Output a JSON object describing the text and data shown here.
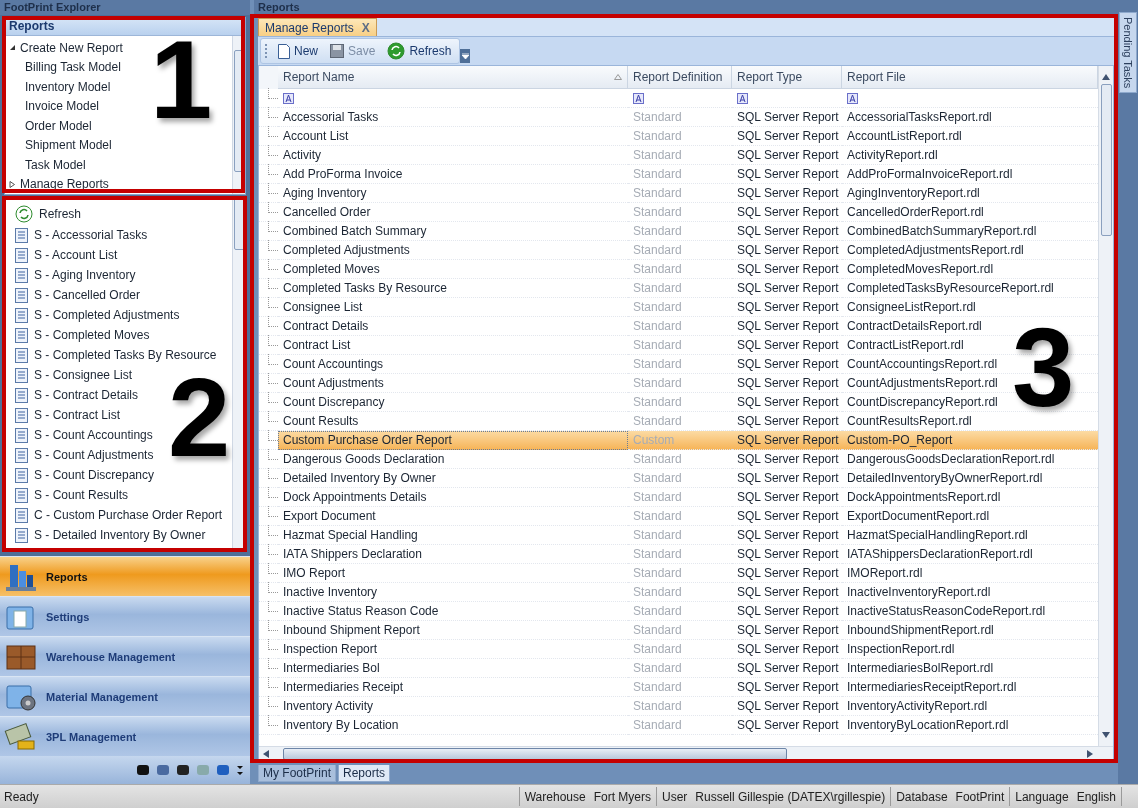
{
  "left_pane": {
    "title": "FootPrint Explorer",
    "section_title": "Reports",
    "tree": [
      {
        "label": "Create New Report",
        "expanded": true,
        "children": [
          {
            "label": "Billing Task Model"
          },
          {
            "label": "Inventory Model"
          },
          {
            "label": "Invoice Model"
          },
          {
            "label": "Order Model"
          },
          {
            "label": "Shipment Model"
          },
          {
            "label": "Task Model"
          }
        ]
      },
      {
        "label": "Manage Reports",
        "expanded": false
      }
    ],
    "refresh": "Refresh",
    "report_list": [
      "S - Accessorial Tasks",
      "S - Account List",
      "S - Aging Inventory",
      "S - Cancelled Order",
      "S - Completed Adjustments",
      "S - Completed Moves",
      "S - Completed Tasks By Resource",
      "S - Consignee List",
      "S - Contract Details",
      "S - Contract List",
      "S - Count Accountings",
      "S - Count Adjustments",
      "S - Count Discrepancy",
      "S - Count Results",
      "C - Custom Purchase Order Report",
      "S - Detailed Inventory By Owner"
    ],
    "nav": [
      {
        "label": "Reports",
        "selected": true,
        "kind": "reports"
      },
      {
        "label": "Settings",
        "selected": false,
        "kind": "settings"
      },
      {
        "label": "Warehouse Management",
        "selected": false,
        "kind": "warehouse"
      },
      {
        "label": "Material Management",
        "selected": false,
        "kind": "material"
      },
      {
        "label": "3PL Management",
        "selected": false,
        "kind": "thirdparty"
      }
    ]
  },
  "main": {
    "title": "Reports",
    "tabs": [
      {
        "label": "Manage Reports",
        "selected": true,
        "close": "X"
      }
    ],
    "toolbar": [
      {
        "label": "New",
        "kind": "new",
        "disabled": false
      },
      {
        "label": "Save",
        "kind": "save",
        "disabled": true
      },
      {
        "label": "Refresh",
        "kind": "refresh",
        "disabled": false
      }
    ],
    "table": {
      "columns": [
        "Report Name",
        "Report Definition",
        "Report Type",
        "Report File"
      ],
      "rows": [
        {
          "selected": false,
          "cells": [
            "Accessorial Tasks",
            "Standard",
            "SQL Server Report",
            "AccessorialTasksReport.rdl"
          ]
        },
        {
          "selected": false,
          "cells": [
            "Account List",
            "Standard",
            "SQL Server Report",
            "AccountListReport.rdl"
          ]
        },
        {
          "selected": false,
          "cells": [
            "Activity",
            "Standard",
            "SQL Server Report",
            "ActivityReport.rdl"
          ]
        },
        {
          "selected": false,
          "cells": [
            "Add ProForma Invoice",
            "Standard",
            "SQL Server Report",
            "AddProFormaInvoiceReport.rdl"
          ]
        },
        {
          "selected": false,
          "cells": [
            "Aging Inventory",
            "Standard",
            "SQL Server Report",
            "AgingInventoryReport.rdl"
          ]
        },
        {
          "selected": false,
          "cells": [
            "Cancelled Order",
            "Standard",
            "SQL Server Report",
            "CancelledOrderReport.rdl"
          ]
        },
        {
          "selected": false,
          "cells": [
            "Combined Batch Summary",
            "Standard",
            "SQL Server Report",
            "CombinedBatchSummaryReport.rdl"
          ]
        },
        {
          "selected": false,
          "cells": [
            "Completed Adjustments",
            "Standard",
            "SQL Server Report",
            "CompletedAdjustmentsReport.rdl"
          ]
        },
        {
          "selected": false,
          "cells": [
            "Completed Moves",
            "Standard",
            "SQL Server Report",
            "CompletedMovesReport.rdl"
          ]
        },
        {
          "selected": false,
          "cells": [
            "Completed Tasks By Resource",
            "Standard",
            "SQL Server Report",
            "CompletedTasksByResourceReport.rdl"
          ]
        },
        {
          "selected": false,
          "cells": [
            "Consignee List",
            "Standard",
            "SQL Server Report",
            "ConsigneeListReport.rdl"
          ]
        },
        {
          "selected": false,
          "cells": [
            "Contract Details",
            "Standard",
            "SQL Server Report",
            "ContractDetailsReport.rdl"
          ]
        },
        {
          "selected": false,
          "cells": [
            "Contract List",
            "Standard",
            "SQL Server Report",
            "ContractListReport.rdl"
          ]
        },
        {
          "selected": false,
          "cells": [
            "Count Accountings",
            "Standard",
            "SQL Server Report",
            "CountAccountingsReport.rdl"
          ]
        },
        {
          "selected": false,
          "cells": [
            "Count Adjustments",
            "Standard",
            "SQL Server Report",
            "CountAdjustmentsReport.rdl"
          ]
        },
        {
          "selected": false,
          "cells": [
            "Count Discrepancy",
            "Standard",
            "SQL Server Report",
            "CountDiscrepancyReport.rdl"
          ]
        },
        {
          "selected": false,
          "cells": [
            "Count Results",
            "Standard",
            "SQL Server Report",
            "CountResultsReport.rdl"
          ]
        },
        {
          "selected": true,
          "cells": [
            "Custom Purchase Order Report",
            "Custom",
            "SQL Server Report",
            "Custom-PO_Report"
          ]
        },
        {
          "selected": false,
          "cells": [
            "Dangerous Goods Declaration",
            "Standard",
            "SQL Server Report",
            "DangerousGoodsDeclarationReport.rdl"
          ]
        },
        {
          "selected": false,
          "cells": [
            "Detailed Inventory By Owner",
            "Standard",
            "SQL Server Report",
            "DetailedInventoryByOwnerReport.rdl"
          ]
        },
        {
          "selected": false,
          "cells": [
            "Dock Appointments Details",
            "Standard",
            "SQL Server Report",
            "DockAppointmentsReport.rdl"
          ]
        },
        {
          "selected": false,
          "cells": [
            "Export Document",
            "Standard",
            "SQL Server Report",
            "ExportDocumentReport.rdl"
          ]
        },
        {
          "selected": false,
          "cells": [
            "Hazmat Special Handling",
            "Standard",
            "SQL Server Report",
            "HazmatSpecialHandlingReport.rdl"
          ]
        },
        {
          "selected": false,
          "cells": [
            "IATA Shippers Declaration",
            "Standard",
            "SQL Server Report",
            "IATAShippersDeclarationReport.rdl"
          ]
        },
        {
          "selected": false,
          "cells": [
            "IMO Report",
            "Standard",
            "SQL Server Report",
            "IMOReport.rdl"
          ]
        },
        {
          "selected": false,
          "cells": [
            "Inactive Inventory",
            "Standard",
            "SQL Server Report",
            "InactiveInventoryReport.rdl"
          ]
        },
        {
          "selected": false,
          "cells": [
            "Inactive Status Reason Code",
            "Standard",
            "SQL Server Report",
            "InactiveStatusReasonCodeReport.rdl"
          ]
        },
        {
          "selected": false,
          "cells": [
            "Inbound Shipment Report",
            "Standard",
            "SQL Server Report",
            "InboundShipmentReport.rdl"
          ]
        },
        {
          "selected": false,
          "cells": [
            "Inspection Report",
            "Standard",
            "SQL Server Report",
            "InspectionReport.rdl"
          ]
        },
        {
          "selected": false,
          "cells": [
            "Intermediaries Bol",
            "Standard",
            "SQL Server Report",
            "IntermediariesBolReport.rdl"
          ]
        },
        {
          "selected": false,
          "cells": [
            "Intermediaries Receipt",
            "Standard",
            "SQL Server Report",
            "IntermediariesReceiptReport.rdl"
          ]
        },
        {
          "selected": false,
          "cells": [
            "Inventory Activity",
            "Standard",
            "SQL Server Report",
            "InventoryActivityReport.rdl"
          ]
        },
        {
          "selected": false,
          "cells": [
            "Inventory By Location",
            "Standard",
            "SQL Server Report",
            "InventoryByLocationReport.rdl"
          ]
        }
      ]
    },
    "bottom_tabs": [
      {
        "label": "My FootPrint",
        "selected": false
      },
      {
        "label": "Reports",
        "selected": true
      }
    ]
  },
  "side_tab": "Pending Tasks",
  "status_bar": {
    "message": "Ready",
    "fields": [
      {
        "label": "Warehouse",
        "value": "Fort Myers"
      },
      {
        "label": "User",
        "value": "Russell Gillespie (DATEX\\rgillespie)"
      },
      {
        "label": "Database",
        "value": "FootPrint"
      },
      {
        "label": "Language",
        "value": "English"
      }
    ]
  },
  "annotations": [
    {
      "label": "1"
    },
    {
      "label": "2"
    },
    {
      "label": "3"
    }
  ]
}
